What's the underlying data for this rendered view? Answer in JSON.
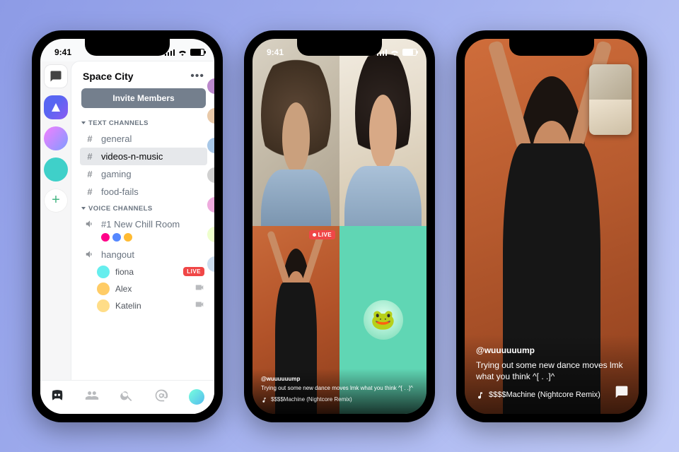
{
  "status": {
    "time": "9:41"
  },
  "phone1": {
    "server_name": "Space City",
    "invite_label": "Invite Members",
    "cat_text": "TEXT CHANNELS",
    "cat_voice": "VOICE CHANNELS",
    "text_channels": {
      "c0": "general",
      "c1": "videos-n-music",
      "c2": "gaming",
      "c3": "food-fails"
    },
    "voice_channels": {
      "v0": "#1 New Chill Room",
      "v1": "hangout"
    },
    "members": {
      "m0": "fiona",
      "m1": "Alex",
      "m2": "Katelin"
    },
    "live_label": "LIVE"
  },
  "phone2": {
    "live_label": "LIVE",
    "handle": "@wuuuuuump",
    "caption_text": "Trying out some new dance moves lmk what you think ^[ . .]^",
    "now_playing": "$$$$Machine (Nightcore Remix)"
  },
  "phone3": {
    "handle": "@wuuuuuump",
    "caption_text": "Trying out some new dance moves lmk what you think ^[ . .]^",
    "now_playing": "$$$$Machine (Nightcore Remix)"
  }
}
